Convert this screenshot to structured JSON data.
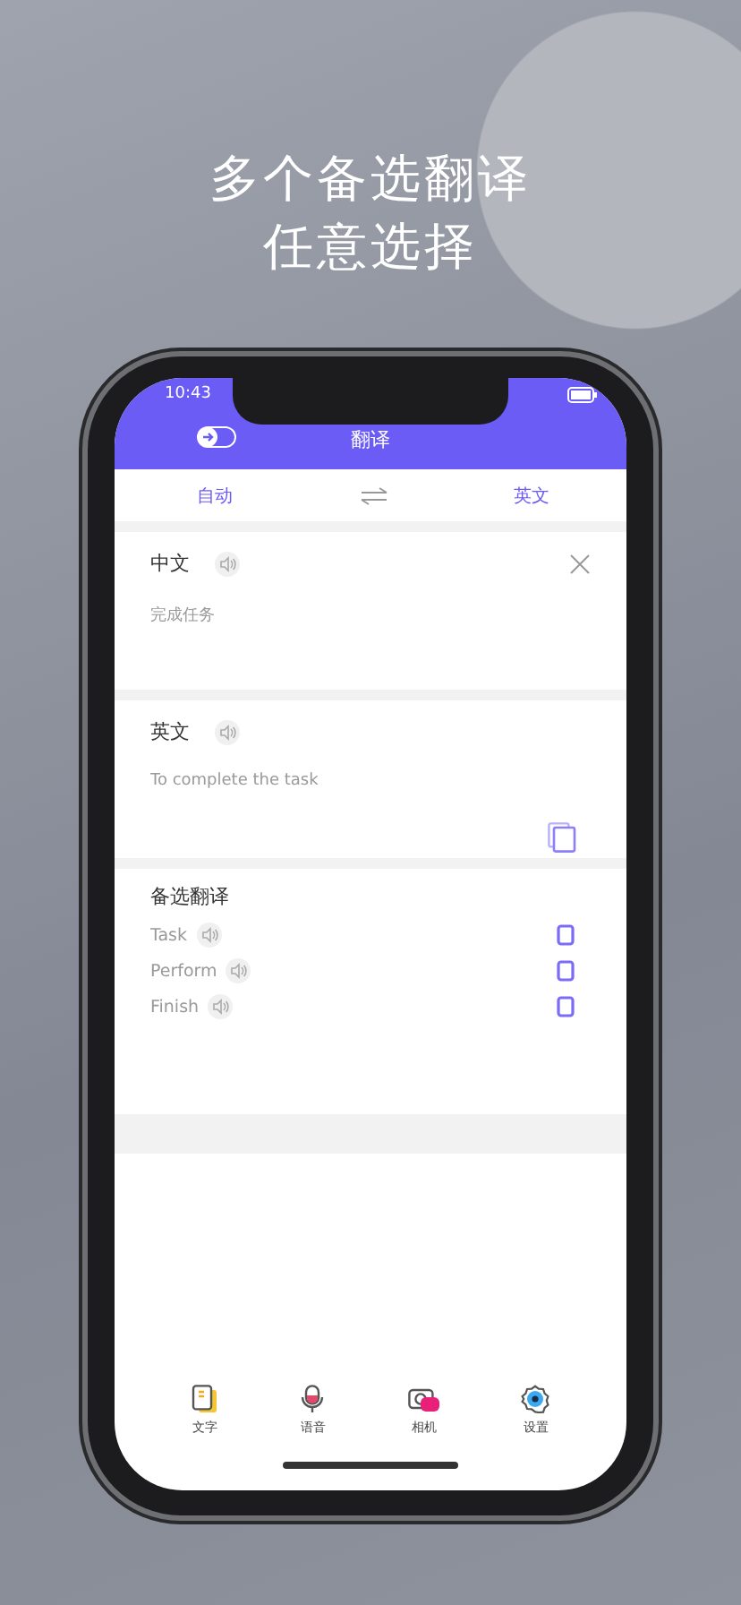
{
  "headline": [
    "多个备选翻译",
    "任意选择"
  ],
  "status_bar": {
    "time": "10:43"
  },
  "app_bar": {
    "title": "翻译"
  },
  "language_bar": {
    "source": "自动",
    "target": "英文"
  },
  "source_panel": {
    "language": "中文",
    "text": "完成任务"
  },
  "result_panel": {
    "language": "英文",
    "text": "To complete the task"
  },
  "alternatives": {
    "title": "备选翻译",
    "items": [
      {
        "text": "Task"
      },
      {
        "text": "Perform"
      },
      {
        "text": "Finish"
      }
    ]
  },
  "tab_bar": [
    {
      "label": "文字",
      "kind": "text"
    },
    {
      "label": "语音",
      "kind": "voice"
    },
    {
      "label": "相机",
      "kind": "camera"
    },
    {
      "label": "设置",
      "kind": "settings"
    }
  ]
}
